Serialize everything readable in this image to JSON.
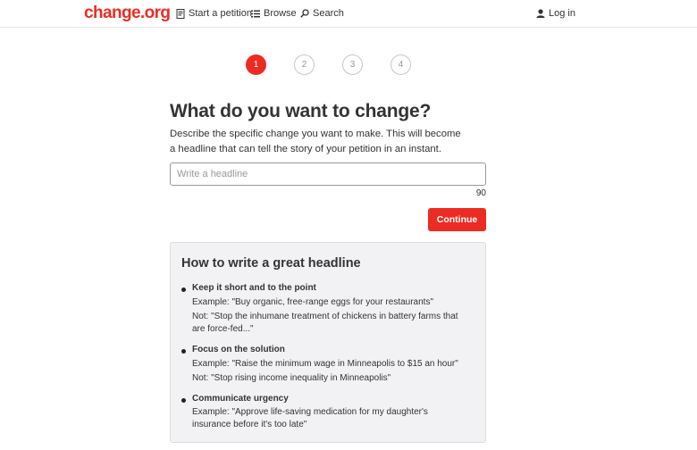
{
  "header": {
    "logo": "change.org",
    "nav": {
      "start_petition": "Start a petition",
      "browse": "Browse",
      "search": "Search",
      "login": "Log in"
    }
  },
  "steps": {
    "items": [
      "1",
      "2",
      "3",
      "4"
    ],
    "active": "1"
  },
  "main": {
    "title": "What do you want to change?",
    "description": "Describe the specific change you want to make. This will become a headline that can tell the story of your petition in an instant.",
    "headline_input": {
      "value": "",
      "placeholder": "Write a headline"
    },
    "char_counter": "90",
    "continue_label": "Continue"
  },
  "tips": {
    "title": "How to write a great headline",
    "items": [
      {
        "heading": "Keep it short and to the point",
        "example": "Example: \"Buy organic, free-range eggs for your restaurants\"",
        "not": "Not: \"Stop the inhumane treatment of chickens in battery farms that are force-fed...\""
      },
      {
        "heading": "Focus on the solution",
        "example": "Example: \"Raise the minimum wage in Minneapolis to $15 an hour\"",
        "not": "Not: \"Stop rising income inequality in Minneapolis\""
      },
      {
        "heading": "Communicate urgency",
        "example": "Example: \"Approve life-saving medication for my daughter's insurance before it's too late\""
      }
    ]
  },
  "colors": {
    "brand": "#ec2c22",
    "text": "#333333",
    "panel": "#f2f2f4"
  },
  "icons": {
    "start_petition": "document-icon",
    "browse": "list-icon",
    "search": "search-icon",
    "login": "user-icon"
  }
}
